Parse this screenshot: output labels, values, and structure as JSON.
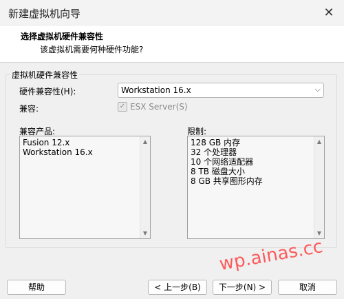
{
  "window": {
    "title": "新建虚拟机向导"
  },
  "header": {
    "title": "选择虚拟机硬件兼容性",
    "subtitle": "该虚拟机需要何种硬件功能?"
  },
  "group": {
    "legend": "虚拟机硬件兼容性",
    "hw_label": "硬件兼容性(H):",
    "hw_value": "Workstation 16.x",
    "compat_label": "兼容:",
    "esx_label": "ESX Server(S)",
    "esx_checked": true
  },
  "products": {
    "label": "兼容产品:",
    "items": [
      "Fusion 12.x",
      "Workstation 16.x"
    ]
  },
  "limits": {
    "label": "限制:",
    "items": [
      "128 GB 内存",
      "32 个处理器",
      "10 个网络适配器",
      "8 TB 磁盘大小",
      "8 GB 共享图形内存"
    ]
  },
  "buttons": {
    "help": "帮助",
    "back": "< 上一步(B)",
    "next": "下一步(N) >",
    "cancel": "取消"
  },
  "watermark": "wp.ainas.cc"
}
